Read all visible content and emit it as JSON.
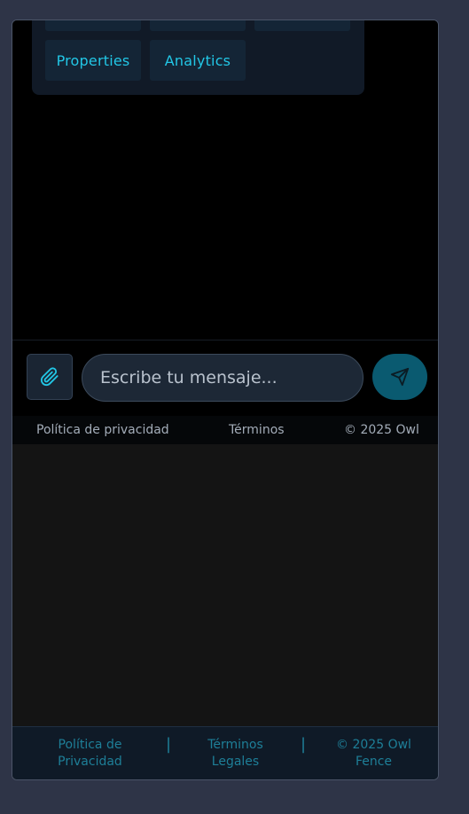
{
  "quick_actions": {
    "row1": [
      "",
      "",
      ""
    ],
    "row2": [
      "Properties",
      "Analytics"
    ]
  },
  "composer": {
    "attach_icon": "paperclip-icon",
    "placeholder": "Escribe tu mensaje...",
    "send_icon": "send-icon"
  },
  "footer_small": {
    "privacy": "Política de privacidad",
    "terms": "Términos",
    "copyright": "© 2025 Owl"
  },
  "footer": {
    "privacy_line1": "Política de",
    "privacy_line2": "Privacidad",
    "separator": "|",
    "terms_line1": "Términos",
    "terms_line2": "Legales",
    "copyright_line1": "© 2025 Owl",
    "copyright_line2": "Fence"
  },
  "colors": {
    "accent": "#22c7e6",
    "background": "#2e3447",
    "send_button": "#0a5a70"
  }
}
